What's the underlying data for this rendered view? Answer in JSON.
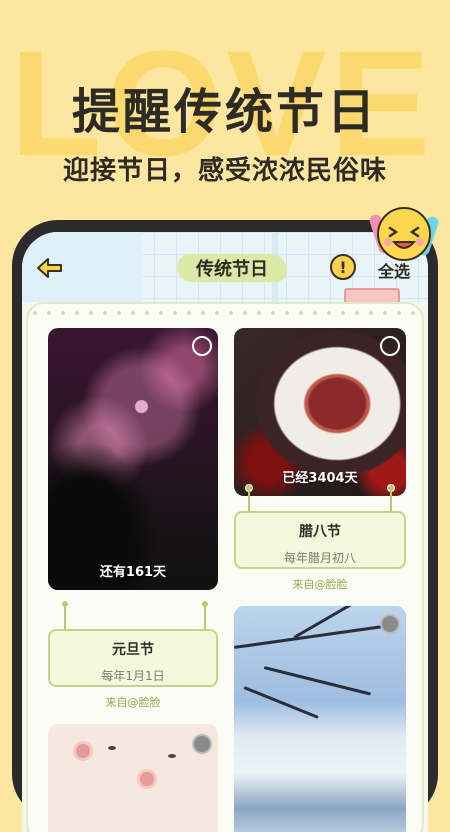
{
  "background_word": "LOVE",
  "headline": "提醒传统节日",
  "subline": "迎接节日，感受浓浓民俗味",
  "app": {
    "title": "传统节日",
    "select_all": "全选",
    "warning_icon_glyph": "!"
  },
  "cards": [
    {
      "image": "fireworks",
      "caption": "还有161天",
      "name": "元旦节",
      "date": "每年1月1日",
      "source": "来自@脸脸"
    },
    {
      "image": "laba-porridge",
      "caption": "已经3404天",
      "name": "腊八节",
      "date": "每年腊月初八",
      "source": "来自@脸脸"
    },
    {
      "image": "flowers"
    },
    {
      "image": "snow-branches"
    }
  ],
  "colors": {
    "page_bg": "#fde7a0",
    "accent_green": "#b6cc6a",
    "label_bg": "#f4f8dc",
    "title_blob": "#dce9a6"
  }
}
